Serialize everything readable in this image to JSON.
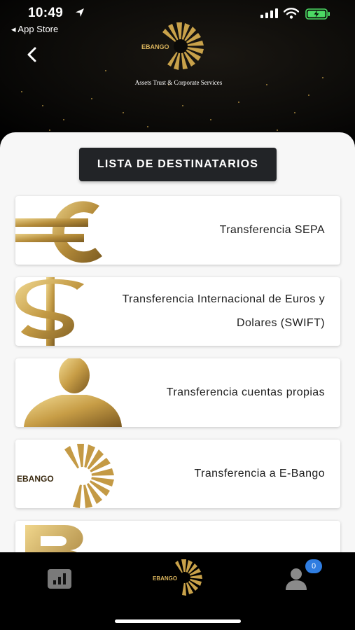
{
  "status_bar": {
    "time": "10:49",
    "back_app": "◂ App Store"
  },
  "header": {
    "logo_text": "EBANGO",
    "tagline": "Assets Trust & Corporate Services"
  },
  "main": {
    "list_title": "LISTA DE DESTINATARIOS",
    "cards": [
      {
        "label": "Transferencia SEPA",
        "icon": "euro-icon"
      },
      {
        "label_line1": "Transferencia Internacional de Euros y",
        "label_line2": "Dolares (SWIFT)",
        "icon": "dollar-icon"
      },
      {
        "label": "Transferencia cuentas propias",
        "icon": "person-icon"
      },
      {
        "label": "Transferencia a E-Bango",
        "icon": "ebango-logo-icon"
      },
      {
        "label": "",
        "icon": "bitcoin-icon"
      }
    ]
  },
  "bottom_nav": {
    "badge_count": "0",
    "logo_text": "EBANGO"
  },
  "colors": {
    "gold": "#c9a24a",
    "dark_button": "#222427",
    "badge_blue": "#2f7de1",
    "battery_green": "#4cd964"
  }
}
